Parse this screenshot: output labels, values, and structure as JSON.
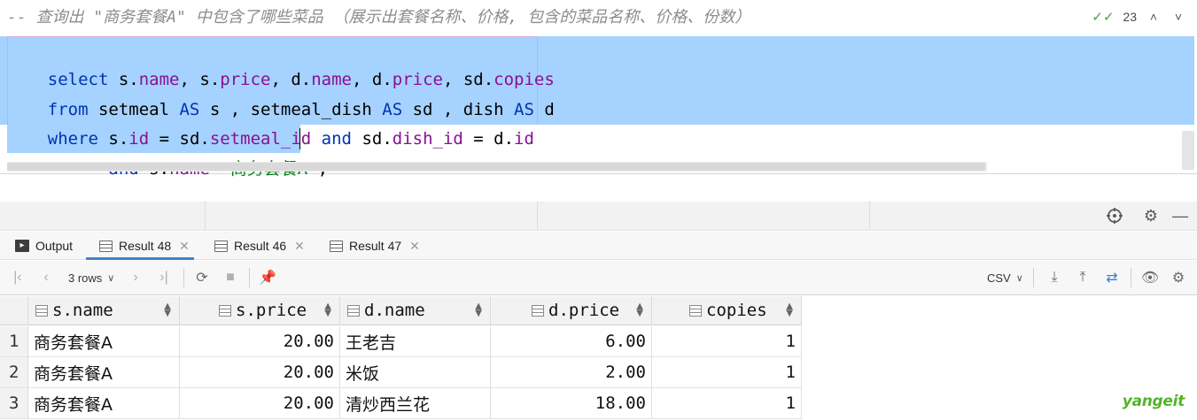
{
  "editor": {
    "comment": "-- 查询出 \"商务套餐A\" 中包含了哪些菜品 （展示出套餐名称、价格, 包含的菜品名称、价格、份数）",
    "line1": [
      "select",
      " s.",
      "name",
      ", s.",
      "price",
      ", d.",
      "name",
      ", d.",
      "price",
      ", sd.",
      "copies"
    ],
    "line2": [
      "from",
      " setmeal ",
      "AS",
      " s , setmeal_dish ",
      "AS",
      " sd , dish ",
      "AS",
      " d"
    ],
    "line3": [
      "where",
      " s.",
      "id",
      " = sd.",
      "setmeal_id",
      " ",
      "and",
      " sd.",
      "dish_id",
      " = d.",
      "id"
    ],
    "line4": [
      "      ",
      "and",
      " s.",
      "name",
      "=",
      "'商务套餐A'",
      ";"
    ]
  },
  "inspection": {
    "check_icon": "double-check-icon",
    "count": "23",
    "up": "˄",
    "down": "˅"
  },
  "tabs": [
    {
      "label": "Output",
      "icon": "output-icon",
      "closable": false
    },
    {
      "label": "Result 48",
      "icon": "table-icon",
      "closable": true,
      "active": true
    },
    {
      "label": "Result 46",
      "icon": "table-icon",
      "closable": true
    },
    {
      "label": "Result 47",
      "icon": "table-icon",
      "closable": true
    }
  ],
  "toolbar": {
    "rows_label": "3 rows",
    "format_label": "CSV"
  },
  "grid": {
    "columns": [
      "s.name",
      "s.price",
      "d.name",
      "d.price",
      "copies"
    ],
    "rows": [
      {
        "num": "1",
        "cells": [
          "商务套餐A",
          "20.00",
          "王老吉",
          "6.00",
          "1"
        ]
      },
      {
        "num": "2",
        "cells": [
          "商务套餐A",
          "20.00",
          "米饭",
          "2.00",
          "1"
        ]
      },
      {
        "num": "3",
        "cells": [
          "商务套餐A",
          "20.00",
          "清炒西兰花",
          "18.00",
          "1"
        ]
      }
    ]
  },
  "watermark": "yangeit",
  "colors": {
    "selection": "#a6d2ff",
    "keyword": "#0033b3",
    "field": "#871094",
    "string": "#067d17",
    "comment": "#8c8c8c",
    "tab_accent": "#4083c9",
    "watermark": "#52b52a"
  }
}
